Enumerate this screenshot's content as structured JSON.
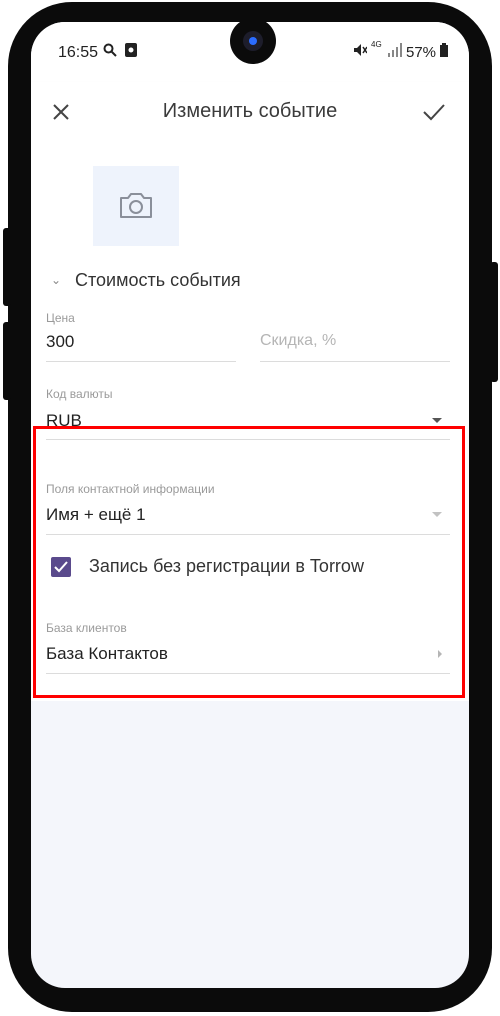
{
  "status_bar": {
    "time": "16:55",
    "battery": "57%",
    "network": "4G"
  },
  "app_bar": {
    "title": "Изменить событие"
  },
  "section": {
    "title": "Стоимость события"
  },
  "price": {
    "label": "Цена",
    "value": "300"
  },
  "discount": {
    "placeholder": "Скидка, %"
  },
  "currency": {
    "label": "Код валюты",
    "value": "RUB"
  },
  "contact_fields": {
    "label": "Поля контактной информации",
    "value": "Имя + ещё 1"
  },
  "registration": {
    "label": "Запись без регистрации в Torrow",
    "checked": true
  },
  "client_base": {
    "label": "База клиентов",
    "value": "База Контактов"
  },
  "colors": {
    "accent": "#5a4a8c",
    "highlight": "#ff0000"
  }
}
